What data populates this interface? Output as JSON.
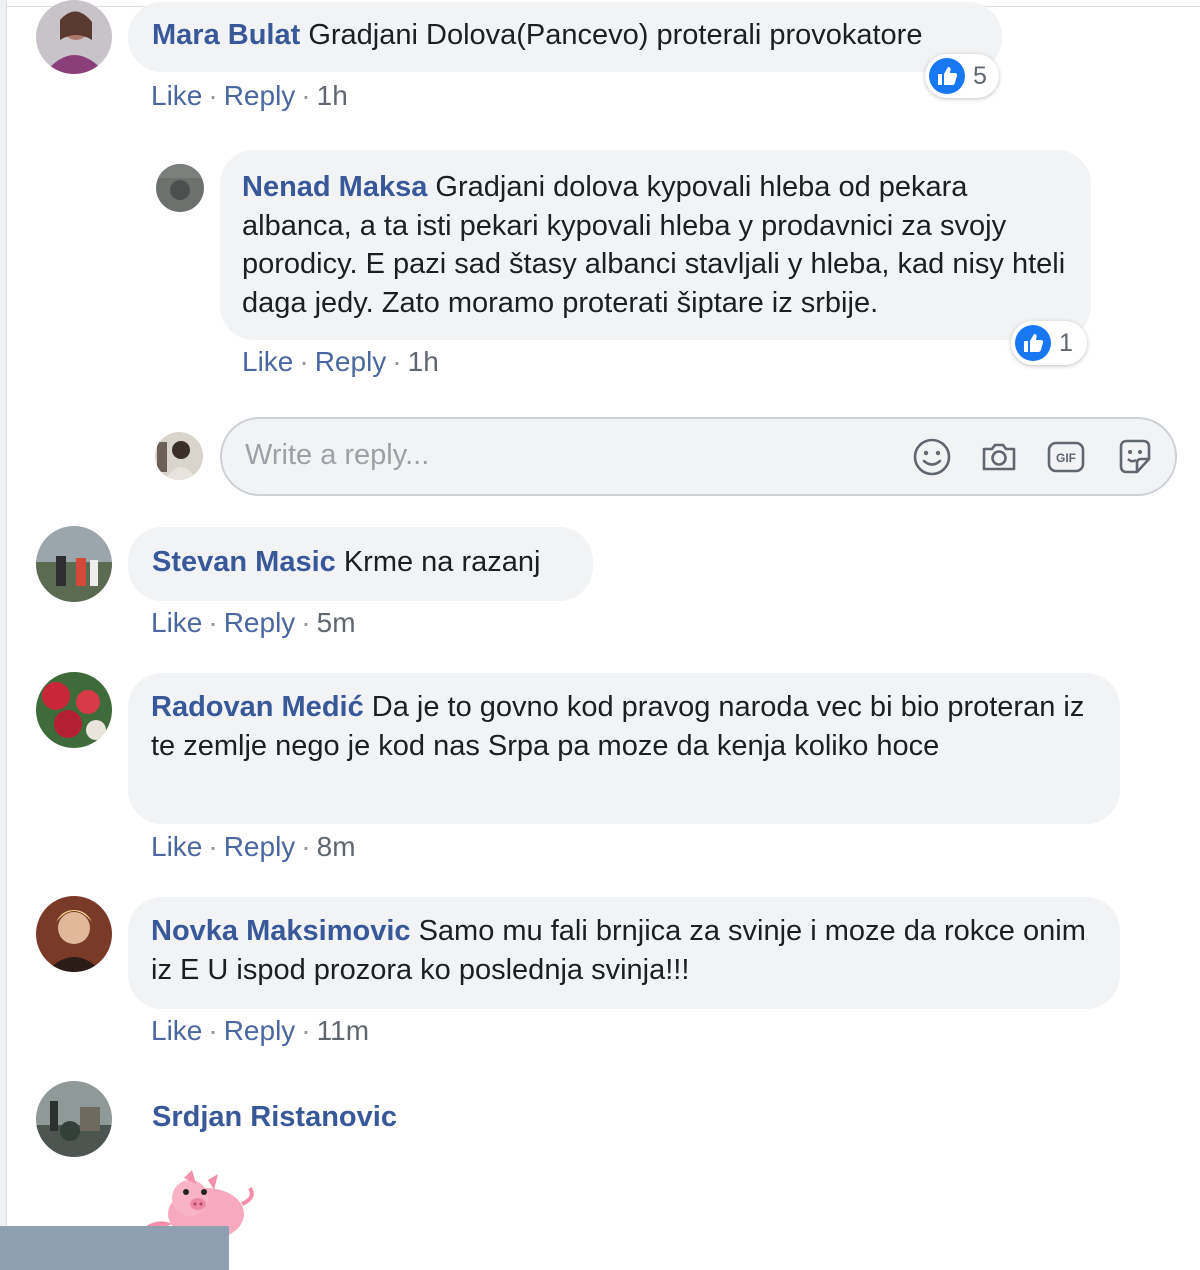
{
  "comments": [
    {
      "author": "Mara Bulat",
      "text": "Gradjani Dolova(Pancevo) proterali provokatore",
      "like": "Like",
      "reply": "Reply",
      "time": "1h",
      "reactions": "5"
    },
    {
      "author": "Nenad Maksa",
      "text": "Gradjani dolova kypovali hleba od pekara albanca, a ta isti pekari kypovali hleba y prodavnici za svojy porodicy. E pazi sad štasy albanci stavljali y hleba, kad nisy hteli daga jedy. Zato moramo proterati šiptare iz srbije.",
      "like": "Like",
      "reply": "Reply",
      "time": "1h",
      "reactions": "1"
    },
    {
      "author": "Stevan Masic",
      "text": "Krme na razanj",
      "like": "Like",
      "reply": "Reply",
      "time": "5m"
    },
    {
      "author": "Radovan Medić",
      "text": "Da je to govno kod pravog naroda vec bi bio proteran iz te zemlje nego je kod nas Srpa pa moze da kenja koliko hoce",
      "like": "Like",
      "reply": "Reply",
      "time": "8m"
    },
    {
      "author": "Novka Maksimovic",
      "text": "Samo mu fali brnjica za svinje i moze da rokce onim iz E U ispod prozora ko poslednja svinja!!!",
      "like": "Like",
      "reply": "Reply",
      "time": "11m"
    },
    {
      "author": "Srdjan Ristanovic"
    }
  ],
  "reply_box": {
    "placeholder": "Write a reply...",
    "icons": [
      "smile-icon",
      "camera-icon",
      "gif-icon",
      "sticker-icon"
    ],
    "gif_label": "GIF"
  },
  "sep": "·",
  "colors": {
    "author": "#385898",
    "bubble": "#f2f3f5",
    "like": "#1877f2",
    "action": "#4b67a1"
  }
}
